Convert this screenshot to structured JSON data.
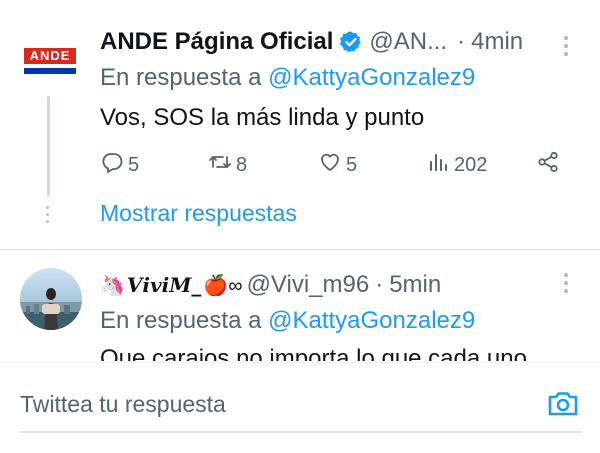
{
  "tweets": [
    {
      "author_name": "ANDE Página Oficial",
      "handle": "@AN...",
      "separator": "·",
      "time": "4min",
      "avatar_text": "ANDE",
      "reply_prefix": "En respuesta a",
      "reply_to": "@KattyaGonzalez9",
      "text": "Vos, SOS la más linda y punto",
      "stats": {
        "replies": "5",
        "retweets": "8",
        "likes": "5",
        "views": "202"
      },
      "show_replies": "Mostrar respuestas"
    },
    {
      "author_name": "𝑽𝒊𝒗𝒊𝑴_",
      "author_suffix": "🍎∞",
      "handle": "@Vivi_m96",
      "separator": "·",
      "time": "5min",
      "reply_prefix": "En respuesta a",
      "reply_to": "@KattyaGonzalez9",
      "text": "Que carajos no importa lo que cada uno"
    }
  ],
  "compose": {
    "placeholder": "Twittea tu respuesta"
  },
  "colors": {
    "accent": "#1d9bf0",
    "secondary_text": "#536471",
    "ande_red": "#d52b1e",
    "ande_blue": "#0038a8"
  },
  "icons": [
    "verified-badge-icon",
    "more-options-icon",
    "reply-icon",
    "retweet-icon",
    "like-icon",
    "views-icon",
    "share-icon",
    "camera-icon"
  ]
}
